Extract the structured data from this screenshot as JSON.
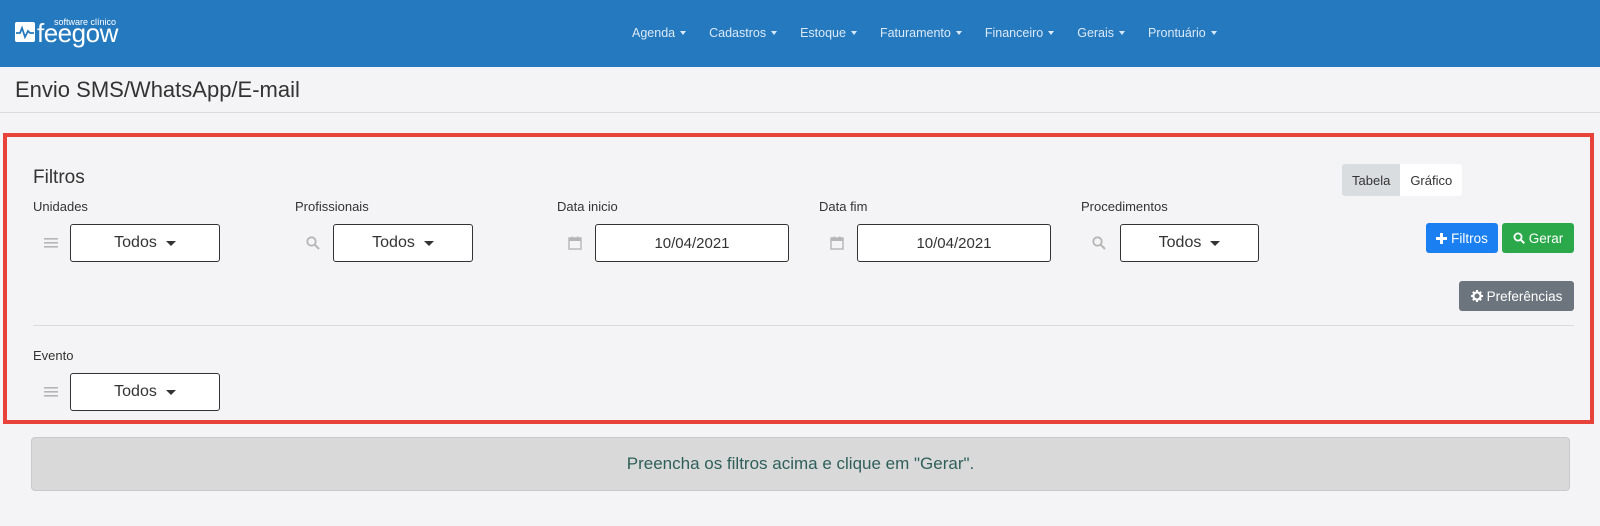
{
  "app": {
    "logo_tagline": "software clínico",
    "logo_brand": "feegow",
    "nav": [
      "Agenda",
      "Cadastros",
      "Estoque",
      "Faturamento",
      "Financeiro",
      "Gerais",
      "Prontuário"
    ]
  },
  "page": {
    "title": "Envio SMS/WhatsApp/E-mail"
  },
  "filters": {
    "heading": "Filtros",
    "unidades": {
      "label": "Unidades",
      "value": "Todos"
    },
    "profissionais": {
      "label": "Profissionais",
      "value": "Todos"
    },
    "data_inicio": {
      "label": "Data inicio",
      "value": "10/04/2021"
    },
    "data_fim": {
      "label": "Data fim",
      "value": "10/04/2021"
    },
    "procedimentos": {
      "label": "Procedimentos",
      "value": "Todos"
    },
    "evento": {
      "label": "Evento",
      "value": "Todos"
    }
  },
  "view_toggle": {
    "tabela": "Tabela",
    "grafico": "Gráfico",
    "active": "Tabela"
  },
  "actions": {
    "filtros": "Filtros",
    "gerar": "Gerar",
    "preferencias": "Preferências"
  },
  "notice": "Preencha os filtros acima e clique em \"Gerar\".",
  "colors": {
    "topbar": "#2579bf",
    "highlight_border": "#e8433a",
    "btn_blue": "#1a7ff0",
    "btn_green": "#2ba84a",
    "btn_gray": "#6c757d"
  }
}
